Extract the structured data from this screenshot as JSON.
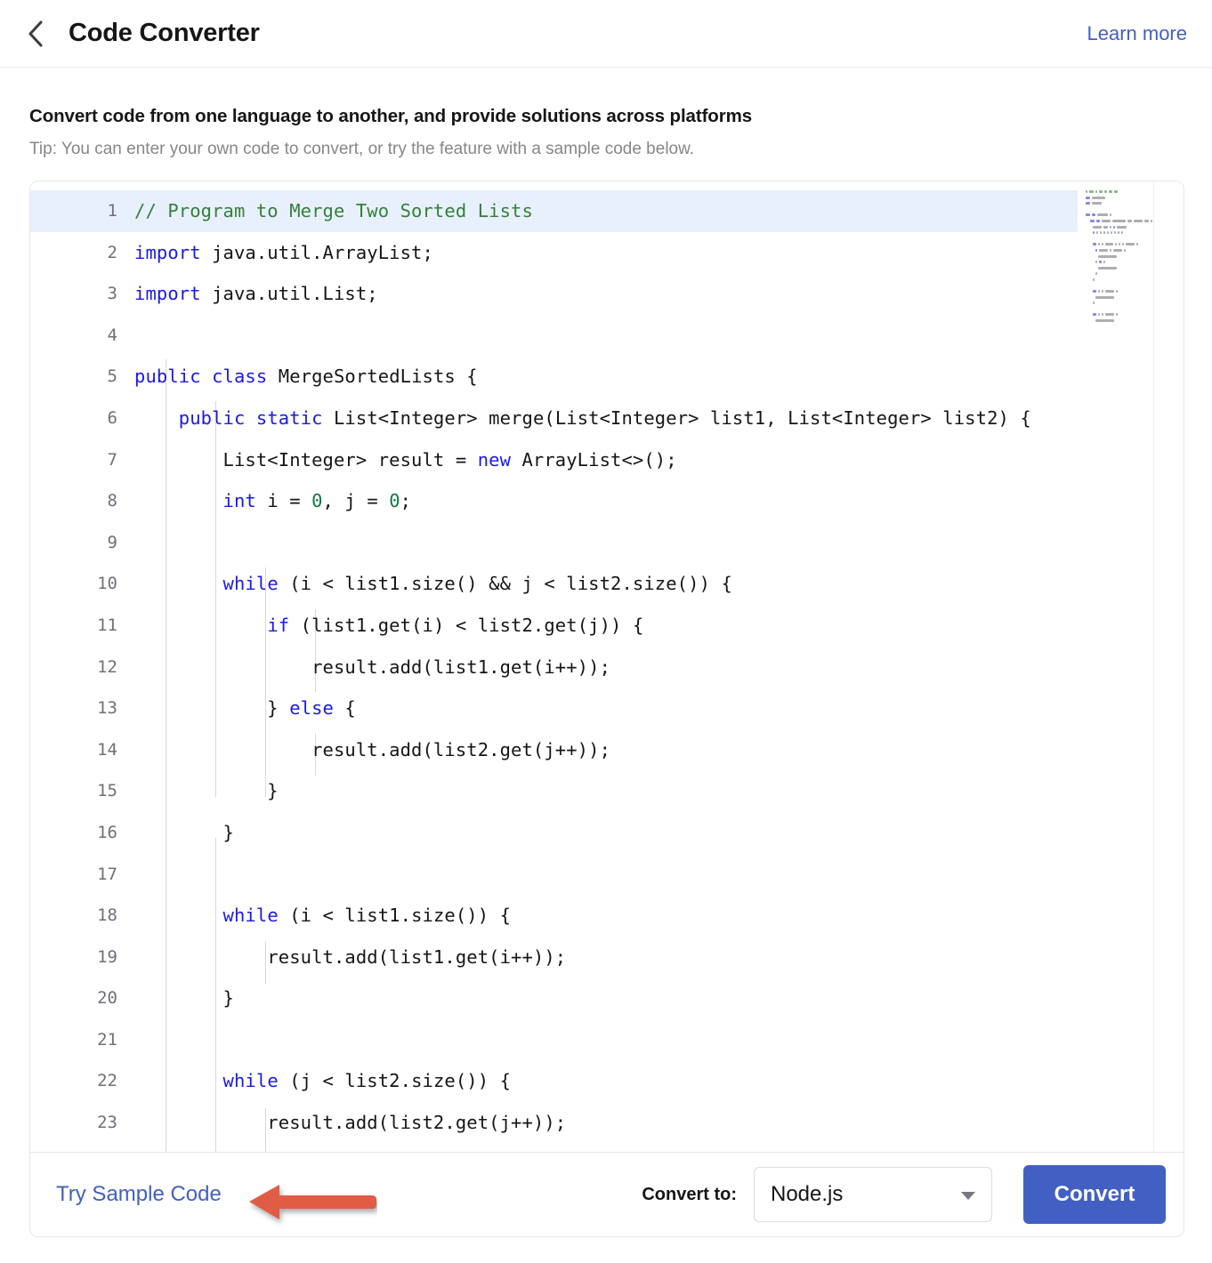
{
  "header": {
    "back_icon": "chevron-left-icon",
    "title": "Code Converter",
    "learn_more": "Learn more"
  },
  "intro": {
    "title": "Convert code from one language to another, and provide solutions across platforms",
    "tip": "Tip: You can enter your own code to convert, or try the feature with a sample code below."
  },
  "editor": {
    "language": "java",
    "active_line": 1,
    "highlight_color": "#e8f0fd",
    "keyword_color": "#1a1ae8",
    "comment_color": "#358039",
    "number_color": "#0e7a42",
    "lines": [
      {
        "n": "1",
        "tokens": [
          {
            "t": "// Program to Merge Two Sorted Lists",
            "c": "cm"
          }
        ]
      },
      {
        "n": "2",
        "tokens": [
          {
            "t": "import",
            "c": "kw"
          },
          {
            "t": " java.util.ArrayList;",
            "c": "pl"
          }
        ]
      },
      {
        "n": "3",
        "tokens": [
          {
            "t": "import",
            "c": "kw"
          },
          {
            "t": " java.util.List;",
            "c": "pl"
          }
        ]
      },
      {
        "n": "4",
        "tokens": [
          {
            "t": "",
            "c": "pl"
          }
        ]
      },
      {
        "n": "5",
        "tokens": [
          {
            "t": "public",
            "c": "kw"
          },
          {
            "t": " ",
            "c": "pl"
          },
          {
            "t": "class",
            "c": "kw"
          },
          {
            "t": " MergeSortedLists {",
            "c": "pl"
          }
        ]
      },
      {
        "n": "6",
        "tokens": [
          {
            "t": "    ",
            "c": "pl"
          },
          {
            "t": "public",
            "c": "kw"
          },
          {
            "t": " ",
            "c": "pl"
          },
          {
            "t": "static",
            "c": "kw"
          },
          {
            "t": " List<Integer> merge(List<Integer> list1, List<Integer> list2) {",
            "c": "pl"
          }
        ]
      },
      {
        "n": "7",
        "tokens": [
          {
            "t": "        List<Integer> result = ",
            "c": "pl"
          },
          {
            "t": "new",
            "c": "kw"
          },
          {
            "t": " ArrayList<>();",
            "c": "pl"
          }
        ]
      },
      {
        "n": "8",
        "tokens": [
          {
            "t": "        ",
            "c": "pl"
          },
          {
            "t": "int",
            "c": "kw"
          },
          {
            "t": " i = ",
            "c": "pl"
          },
          {
            "t": "0",
            "c": "num"
          },
          {
            "t": ", j = ",
            "c": "pl"
          },
          {
            "t": "0",
            "c": "num"
          },
          {
            "t": ";",
            "c": "pl"
          }
        ]
      },
      {
        "n": "9",
        "tokens": [
          {
            "t": "",
            "c": "pl"
          }
        ]
      },
      {
        "n": "10",
        "tokens": [
          {
            "t": "        ",
            "c": "pl"
          },
          {
            "t": "while",
            "c": "kw"
          },
          {
            "t": " (i < list1.size() && j < list2.size()) {",
            "c": "pl"
          }
        ]
      },
      {
        "n": "11",
        "tokens": [
          {
            "t": "            ",
            "c": "pl"
          },
          {
            "t": "if",
            "c": "kw"
          },
          {
            "t": " (list1.get(i) < list2.get(j)) {",
            "c": "pl"
          }
        ]
      },
      {
        "n": "12",
        "tokens": [
          {
            "t": "                result.add(list1.get(i++));",
            "c": "pl"
          }
        ]
      },
      {
        "n": "13",
        "tokens": [
          {
            "t": "            } ",
            "c": "pl"
          },
          {
            "t": "else",
            "c": "kw"
          },
          {
            "t": " {",
            "c": "pl"
          }
        ]
      },
      {
        "n": "14",
        "tokens": [
          {
            "t": "                result.add(list2.get(j++));",
            "c": "pl"
          }
        ]
      },
      {
        "n": "15",
        "tokens": [
          {
            "t": "            }",
            "c": "pl"
          }
        ]
      },
      {
        "n": "16",
        "tokens": [
          {
            "t": "        }",
            "c": "pl"
          }
        ]
      },
      {
        "n": "17",
        "tokens": [
          {
            "t": "",
            "c": "pl"
          }
        ]
      },
      {
        "n": "18",
        "tokens": [
          {
            "t": "        ",
            "c": "pl"
          },
          {
            "t": "while",
            "c": "kw"
          },
          {
            "t": " (i < list1.size()) {",
            "c": "pl"
          }
        ]
      },
      {
        "n": "19",
        "tokens": [
          {
            "t": "            result.add(list1.get(i++));",
            "c": "pl"
          }
        ]
      },
      {
        "n": "20",
        "tokens": [
          {
            "t": "        }",
            "c": "pl"
          }
        ]
      },
      {
        "n": "21",
        "tokens": [
          {
            "t": "",
            "c": "pl"
          }
        ]
      },
      {
        "n": "22",
        "tokens": [
          {
            "t": "        ",
            "c": "pl"
          },
          {
            "t": "while",
            "c": "kw"
          },
          {
            "t": " (j < list2.size()) {",
            "c": "pl"
          }
        ]
      },
      {
        "n": "23",
        "tokens": [
          {
            "t": "            result.add(list2.get(j++));",
            "c": "pl"
          }
        ]
      }
    ]
  },
  "toolbar": {
    "try_sample": "Try Sample Code",
    "convert_to_label": "Convert to:",
    "selected_language": "Node.js",
    "caret_icon": "chevron-down-icon",
    "convert_button": "Convert"
  },
  "annotation": {
    "arrow_icon": "left-arrow-annotation",
    "color": "#e05b45",
    "points_at": "Try Sample Code"
  }
}
